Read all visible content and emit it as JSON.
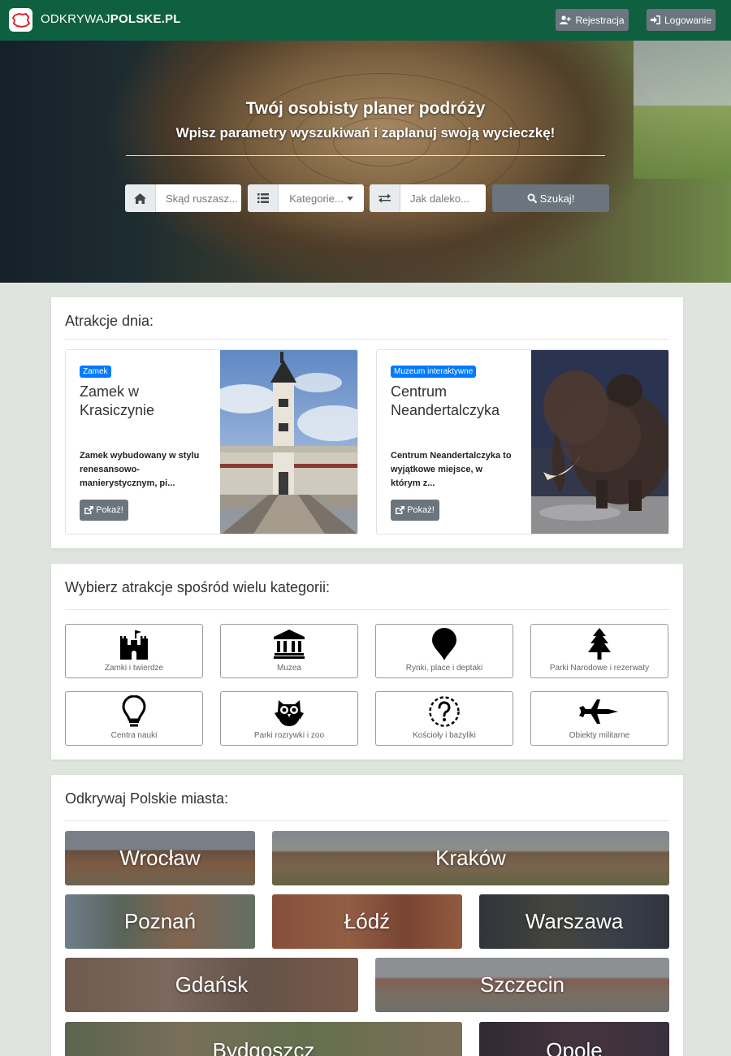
{
  "navbar": {
    "brand_light": "ODKRYWAJ",
    "brand_bold": "POLSKE.PL",
    "register_label": "Rejestracja",
    "login_label": "Logowanie",
    "color": "#0f6040"
  },
  "hero": {
    "title": "Twój osobisty planer podróży",
    "subtitle": "Wpisz parametry wyszukiwań i zaplanuj swoją wycieczkę!",
    "from_placeholder": "Skąd ruszasz...",
    "category_label": "Kategorie...",
    "distance_placeholder": "Jak daleko...",
    "search_label": "Szukaj!"
  },
  "attractions": {
    "title": "Atrakcje dnia:",
    "items": [
      {
        "badge": "Zamek",
        "title": "Zamek w Krasiczynie",
        "desc": "Zamek wybudowany w stylu renesansowo-manierystycznym, pi...",
        "button": "Pokaż!"
      },
      {
        "badge": "Muzeum interaktywne",
        "title": "Centrum Neandertalczyka",
        "desc": "Centrum Neandertalczyka to wyjątkowe miejsce, w którym z...",
        "button": "Pokaż!"
      }
    ]
  },
  "categories": {
    "title": "Wybierz atrakcje spośród wielu kategorii:",
    "items": [
      {
        "label": "Zamki i twierdze",
        "icon": "castle-icon"
      },
      {
        "label": "Muzea",
        "icon": "museum-icon"
      },
      {
        "label": "Rynki, place i deptaki",
        "icon": "map-pin-icon"
      },
      {
        "label": "Parki Narodowe i rezerwaty",
        "icon": "tree-icon"
      },
      {
        "label": "Centra nauki",
        "icon": "lightbulb-icon"
      },
      {
        "label": "Parki rozrywki i zoo",
        "icon": "owl-icon"
      },
      {
        "label": "Kościoły i bazyliki",
        "icon": "question-icon"
      },
      {
        "label": "Obiekty militarne",
        "icon": "fighter-jet-icon"
      }
    ]
  },
  "cities": {
    "title": "Odkrywaj Polskie miasta:",
    "items": [
      {
        "name": "Wrocław"
      },
      {
        "name": "Kraków"
      },
      {
        "name": "Poznań"
      },
      {
        "name": "Łódź"
      },
      {
        "name": "Warszawa"
      },
      {
        "name": "Gdańsk"
      },
      {
        "name": "Szczecin"
      },
      {
        "name": "Bydgoszcz"
      },
      {
        "name": "Opole"
      }
    ]
  }
}
